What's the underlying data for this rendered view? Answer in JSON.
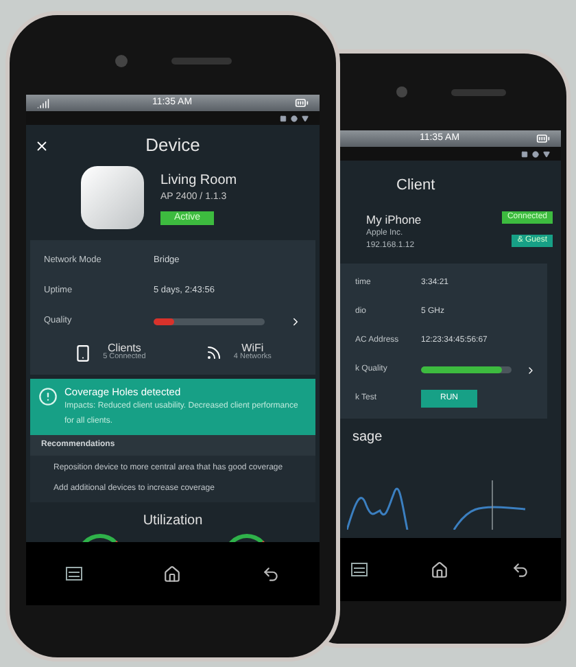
{
  "front_phone": {
    "status_bar": {
      "time": "11:35 AM"
    },
    "header": {
      "title": "Device"
    },
    "device": {
      "name": "Living Room",
      "model": "AP 2400 / 1.1.3",
      "badge": {
        "label": "Active",
        "color": "#3dbb3f"
      }
    },
    "details": [
      {
        "kind": "text",
        "label": "Network Mode",
        "value": "Bridge"
      },
      {
        "kind": "text",
        "label": "Uptime",
        "value": "5 days, 2:43:56"
      },
      {
        "kind": "bar",
        "label": "Quality",
        "level": 0.18,
        "color": "#d8322b"
      }
    ],
    "summary": [
      {
        "kind": "clients",
        "title": "Clients",
        "subtitle": "5 Connected"
      },
      {
        "kind": "wifi",
        "title": "WiFi",
        "subtitle": "4 Networks"
      }
    ],
    "alert": {
      "title": "Coverage Holes detected",
      "text": "Impacts: Reduced client usability. Decreased client performance for all clients."
    },
    "recommendations": {
      "title": "Recommendations",
      "items": [
        "Reposition device to more central area that has good coverage",
        "Add additional devices to increase coverage"
      ]
    },
    "utilization": {
      "title": "Utilization"
    }
  },
  "back_phone": {
    "status_bar": {
      "time": "11:35 AM"
    },
    "header": {
      "title": "Client"
    },
    "client": {
      "name": "My iPhone",
      "vendor": "Apple Inc.",
      "ip": "192.168.1.12",
      "badges": [
        {
          "label": "Connected",
          "color": "#3dbb3f"
        },
        {
          "label": "& Guest",
          "color": "#17a086"
        }
      ]
    },
    "details": [
      {
        "kind": "text",
        "label": "time",
        "value": "3:34:21"
      },
      {
        "kind": "text",
        "label": "dio",
        "value": "5 GHz"
      },
      {
        "kind": "text",
        "label": "AC Address",
        "value": "12:23:34:45:56:67"
      },
      {
        "kind": "bar",
        "label": "k Quality",
        "level": 0.9,
        "color": "#3dbb3f"
      },
      {
        "kind": "button",
        "label": "k Test",
        "value": "RUN"
      }
    ],
    "usage": {
      "title": "sage"
    }
  }
}
